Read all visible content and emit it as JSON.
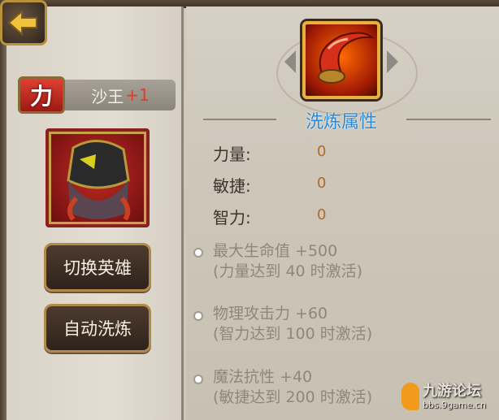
{
  "hero": {
    "attribute_char": "力",
    "name": "沙王",
    "refine_level": "+1"
  },
  "buttons": {
    "switch_hero": "切换英雄",
    "auto_refine": "自动洗炼"
  },
  "refine": {
    "title": "洗炼属性",
    "stats": [
      {
        "label": "力量:",
        "value": "0"
      },
      {
        "label": "敏捷:",
        "value": "0"
      },
      {
        "label": "智力:",
        "value": "0"
      }
    ],
    "bonuses": [
      {
        "effect": "最大生命值 +500",
        "condition": "(力量达到 40 时激活)"
      },
      {
        "effect": "物理攻击力 +60",
        "condition": "(智力达到 100 时激活)"
      },
      {
        "effect": "魔法抗性 +40",
        "condition": "(敏捷达到 200 时激活)"
      }
    ]
  },
  "watermark": {
    "title": "九游论坛",
    "url": "bbs.9game.cn"
  },
  "icons": [
    "back-arrow-icon",
    "hero-portrait",
    "horn-skill-icon",
    "chevron-left-icon",
    "chevron-right-icon",
    "site-logo-icon"
  ],
  "colors": {
    "title_blue": "#2a8ad8",
    "stat_value": "#b06a2a",
    "plus_red": "#e23a2a",
    "button_bg": "#3b2c22",
    "button_border": "#b08a4a"
  }
}
